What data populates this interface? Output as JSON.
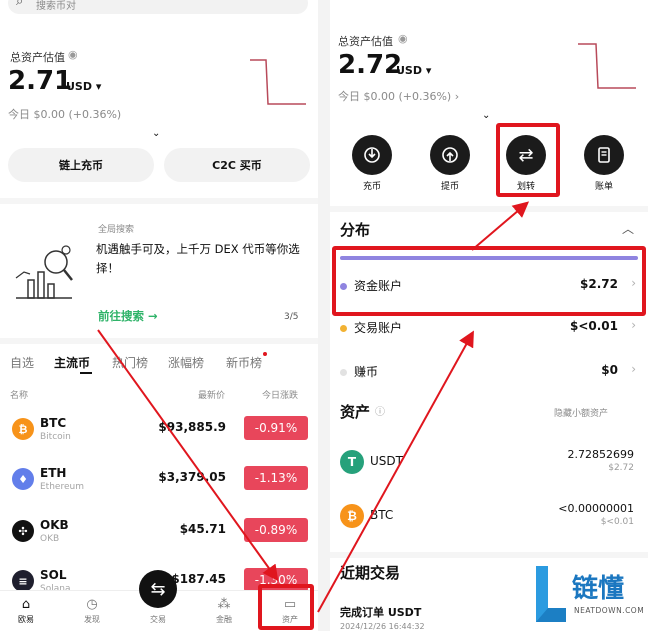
{
  "left": {
    "search_placeholder": "搜索币对",
    "total_label": "总资产估值",
    "total_value": "2.71",
    "total_currency": "USD",
    "today_pnl": "今日 $0.00 (+0.36%)",
    "btn_onchain": "链上充币",
    "btn_c2c": "C2C 买币",
    "promo_title": "全局搜索",
    "promo_text": "机遇触手可及，上千万 DEX 代币等你选择！",
    "promo_link": "前往搜索",
    "promo_page": "3/5",
    "tabs": [
      "自选",
      "主流币",
      "热门榜",
      "涨幅榜",
      "新币榜"
    ],
    "col_name": "名称",
    "col_price": "最新价",
    "col_change": "今日涨跌",
    "coins": [
      {
        "symbol": "BTC",
        "name": "Bitcoin",
        "price": "$93,885.9",
        "change": "-0.91%",
        "color": "#f7931a",
        "glyph": "₿"
      },
      {
        "symbol": "ETH",
        "name": "Ethereum",
        "price": "$3,379.05",
        "change": "-1.13%",
        "color": "#627eea",
        "glyph": "♦"
      },
      {
        "symbol": "OKB",
        "name": "OKB",
        "price": "$45.71",
        "change": "-0.89%",
        "color": "#111111",
        "glyph": "✣"
      },
      {
        "symbol": "SOL",
        "name": "Solana",
        "price": "$187.45",
        "change": "-1.30%",
        "color": "#1f1f2e",
        "glyph": "≡"
      }
    ],
    "nav": [
      {
        "label": "欧易",
        "icon": "home-icon"
      },
      {
        "label": "发现",
        "icon": "discover-icon"
      },
      {
        "label": "交易",
        "icon": "trade-icon"
      },
      {
        "label": "金融",
        "icon": "finance-icon"
      },
      {
        "label": "资产",
        "icon": "assets-icon"
      }
    ]
  },
  "right": {
    "total_label": "总资产估值",
    "total_value": "2.72",
    "total_currency": "USD",
    "today_pnl": "今日 $0.00 (+0.36%)",
    "actions": [
      {
        "label": "充币",
        "icon": "deposit-icon"
      },
      {
        "label": "提币",
        "icon": "withdraw-icon"
      },
      {
        "label": "划转",
        "icon": "transfer-icon"
      },
      {
        "label": "账单",
        "icon": "bill-icon"
      }
    ],
    "distribution_title": "分布",
    "accounts": [
      {
        "name": "资金账户",
        "value": "$2.72",
        "color": "#8f84e0"
      },
      {
        "name": "交易账户",
        "value": "$<0.01",
        "color": "#f2b233"
      },
      {
        "name": "赚币",
        "value": "$0",
        "color": "#e2e2e2"
      }
    ],
    "assets_title": "资产",
    "hide_small": "隐藏小额资产",
    "assets": [
      {
        "symbol": "USDT",
        "amount": "2.72852699",
        "usd": "$2.72",
        "color": "#26a17b",
        "glyph": "T"
      },
      {
        "symbol": "BTC",
        "amount": "<0.00000001",
        "usd": "$<0.01",
        "color": "#f7931a",
        "glyph": "₿"
      }
    ],
    "recent_title": "近期交易",
    "recent_item": "完成订单 USDT",
    "recent_time": "2024/12/26 16:44:32"
  },
  "watermark": {
    "brand": "链懂",
    "url": "NEATDOWN.COM"
  },
  "colors": {
    "highlight_red": "#e0161e",
    "negative": "#e8465b",
    "positive_green": "#2fb369",
    "distribution_bar": "#8f84e0"
  }
}
